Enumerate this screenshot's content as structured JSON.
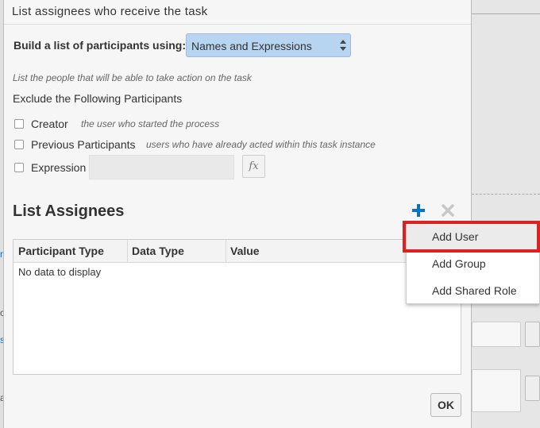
{
  "dialog": {
    "title": "List assignees who receive the task",
    "build_label": "Build a list of participants using:",
    "build_select_value": "Names and Expressions",
    "hint": "List the people that will be able to take action on the task",
    "exclude_title": "Exclude the Following Participants",
    "exclusions": [
      {
        "label": "Creator",
        "description": "the user who started the process",
        "checked": false
      },
      {
        "label": "Previous Participants",
        "description": "users who have already acted within this task instance",
        "checked": false
      },
      {
        "label": "Expression",
        "description": "",
        "checked": false
      }
    ],
    "expression_value": "",
    "fx_label": "fx",
    "section_title": "List Assignees",
    "table": {
      "columns": [
        "Participant Type",
        "Data Type",
        "Value"
      ],
      "empty_text": "No data to display"
    },
    "ok_label": "OK"
  },
  "add_menu": {
    "items": [
      "Add User",
      "Add Group",
      "Add Shared Role"
    ],
    "highlighted": "Add User"
  },
  "colors": {
    "select_bg": "#b7d5f1",
    "plus_icon": "#0572ce",
    "highlight_box": "#e02020"
  }
}
